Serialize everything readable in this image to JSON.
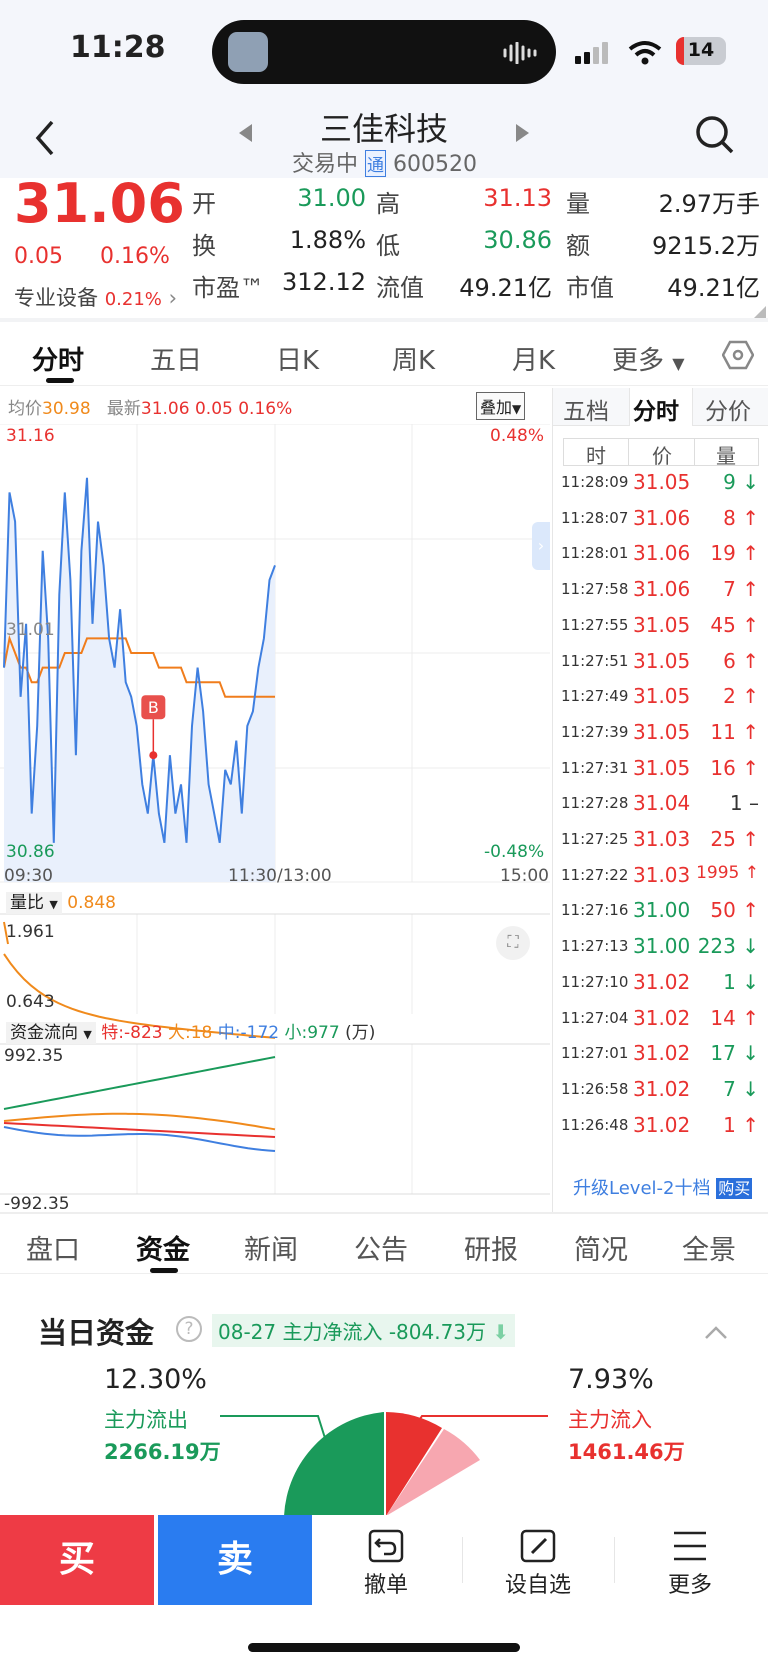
{
  "status": {
    "time": "11:28",
    "battery": "14"
  },
  "header": {
    "title": "三佳科技",
    "status": "交易中",
    "badge": "通",
    "code": "600520"
  },
  "quote": {
    "price": "31.06",
    "change": "0.05",
    "change_pct": "0.16%",
    "sector": "专业设备",
    "sector_pct": "0.21%",
    "rows": [
      [
        {
          "label": "开",
          "value": "31.00",
          "color": "#1a9a5a"
        },
        {
          "label": "高",
          "value": "31.13",
          "color": "#e8312f"
        },
        {
          "label": "量",
          "value": "2.97万手",
          "color": "#222"
        }
      ],
      [
        {
          "label": "换",
          "value": "1.88%",
          "color": "#222"
        },
        {
          "label": "低",
          "value": "30.86",
          "color": "#1a9a5a"
        },
        {
          "label": "额",
          "value": "9215.2万",
          "color": "#222"
        }
      ],
      [
        {
          "label": "市盈™",
          "value": "312.12",
          "color": "#222"
        },
        {
          "label": "流值",
          "value": "49.21亿",
          "color": "#222"
        },
        {
          "label": "市值",
          "value": "49.21亿",
          "color": "#222"
        }
      ]
    ]
  },
  "tabs1": [
    "分时",
    "五日",
    "日K",
    "周K",
    "月K",
    "更多"
  ],
  "chart_info": {
    "avg_label": "均价",
    "avg_value": "30.98",
    "latest_label": "最新",
    "latest_value": "31.06",
    "latest_change": "0.05",
    "latest_pct": "0.16%",
    "overlay": "叠加"
  },
  "chart_data": {
    "type": "line",
    "y_top": "31.16",
    "y_mid": "31.01",
    "y_bottom": "30.86",
    "pct_top": "0.48%",
    "pct_bottom": "-0.48%",
    "x_labels": [
      "09:30",
      "11:30/13:00",
      "15:00"
    ],
    "marker": "B",
    "price": [
      31.0,
      31.12,
      31.1,
      30.98,
      31.03,
      30.9,
      30.96,
      31.08,
      31.02,
      30.88,
      31.05,
      31.12,
      31.06,
      30.94,
      31.08,
      31.13,
      31.03,
      31.1,
      31.07,
      31.02,
      31.0,
      31.04,
      30.99,
      30.98,
      30.96,
      30.92,
      30.9,
      30.94,
      30.9,
      30.88,
      30.94,
      30.9,
      30.92,
      30.88,
      30.96,
      31.0,
      30.97,
      30.92,
      30.9,
      30.88,
      30.93,
      30.92,
      30.95,
      30.9,
      30.96,
      30.97,
      31.0,
      31.02,
      31.06,
      31.07
    ],
    "avg": [
      31.0,
      31.02,
      31.01,
      31.0,
      31.0,
      30.99,
      30.99,
      31.0,
      31.0,
      31.0,
      31.0,
      31.01,
      31.01,
      31.01,
      31.01,
      31.02,
      31.02,
      31.02,
      31.02,
      31.02,
      31.02,
      31.02,
      31.02,
      31.01,
      31.01,
      31.01,
      31.01,
      31.01,
      31.0,
      31.0,
      31.0,
      31.0,
      31.0,
      30.99,
      30.99,
      30.99,
      30.99,
      30.99,
      30.99,
      30.99,
      30.98,
      30.98,
      30.98,
      30.98,
      30.98,
      30.98,
      30.98,
      30.98,
      30.98,
      30.98
    ]
  },
  "volume_ratio": {
    "label": "量比",
    "value": "0.848",
    "top": "1.961",
    "bottom": "0.643"
  },
  "fund_flow": {
    "label": "资金流向",
    "te": "特:-823",
    "da": "大:18",
    "zhong": "中:-172",
    "xiao": "小:977",
    "unit": "(万)",
    "top": "992.35",
    "bottom": "-992.35"
  },
  "tick_tabs": [
    "五档",
    "分时",
    "分价"
  ],
  "tick_headers": [
    "时",
    "价",
    "量"
  ],
  "ticks": [
    {
      "t": "11:28:09",
      "p": "31.05",
      "pc": "r",
      "v": "9",
      "d": "↓"
    },
    {
      "t": "11:28:07",
      "p": "31.06",
      "pc": "r",
      "v": "8",
      "d": "↑"
    },
    {
      "t": "11:28:01",
      "p": "31.06",
      "pc": "r",
      "v": "19",
      "d": "↑"
    },
    {
      "t": "11:27:58",
      "p": "31.06",
      "pc": "r",
      "v": "7",
      "d": "↑"
    },
    {
      "t": "11:27:55",
      "p": "31.05",
      "pc": "r",
      "v": "45",
      "d": "↑"
    },
    {
      "t": "11:27:51",
      "p": "31.05",
      "pc": "r",
      "v": "6",
      "d": "↑"
    },
    {
      "t": "11:27:49",
      "p": "31.05",
      "pc": "r",
      "v": "2",
      "d": "↑"
    },
    {
      "t": "11:27:39",
      "p": "31.05",
      "pc": "r",
      "v": "11",
      "d": "↑"
    },
    {
      "t": "11:27:31",
      "p": "31.05",
      "pc": "r",
      "v": "16",
      "d": "↑"
    },
    {
      "t": "11:27:28",
      "p": "31.04",
      "pc": "r",
      "v": "1",
      "d": "–"
    },
    {
      "t": "11:27:25",
      "p": "31.03",
      "pc": "r",
      "v": "25",
      "d": "↑"
    },
    {
      "t": "11:27:22",
      "p": "31.03",
      "pc": "r",
      "v": "1995",
      "d": "↑"
    },
    {
      "t": "11:27:16",
      "p": "31.00",
      "pc": "g",
      "v": "50",
      "d": "↑"
    },
    {
      "t": "11:27:13",
      "p": "31.00",
      "pc": "g",
      "v": "223",
      "d": "↓"
    },
    {
      "t": "11:27:10",
      "p": "31.02",
      "pc": "r",
      "v": "1",
      "d": "↓"
    },
    {
      "t": "11:27:04",
      "p": "31.02",
      "pc": "r",
      "v": "14",
      "d": "↑"
    },
    {
      "t": "11:27:01",
      "p": "31.02",
      "pc": "r",
      "v": "17",
      "d": "↓"
    },
    {
      "t": "11:26:58",
      "p": "31.02",
      "pc": "r",
      "v": "7",
      "d": "↓"
    },
    {
      "t": "11:26:48",
      "p": "31.02",
      "pc": "r",
      "v": "1",
      "d": "↑"
    }
  ],
  "upgrade": {
    "text": "升级Level-2十档",
    "buy": "购买"
  },
  "tabs2": [
    "盘口",
    "资金",
    "新闻",
    "公告",
    "研报",
    "简况",
    "全景"
  ],
  "funds": {
    "title": "当日资金",
    "tag": "08-27 主力净流入 -804.73万",
    "out_pct": "12.30%",
    "out_label": "主力流出",
    "out_value": "2266.19万",
    "in_pct": "7.93%",
    "in_label": "主力流入",
    "in_value": "1461.46万"
  },
  "bottom": {
    "buy": "买",
    "sell": "卖",
    "cancel": "撤单",
    "watch": "设自选",
    "more": "更多"
  }
}
